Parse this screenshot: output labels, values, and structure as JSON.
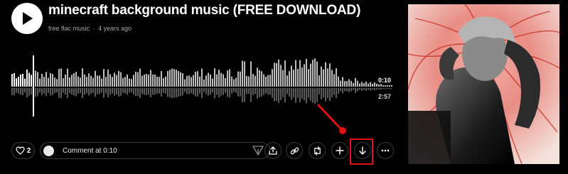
{
  "track": {
    "title": "minecraft background music (FREE DOWNLOAD)",
    "artist": "free flac music",
    "separator": "·",
    "age": "4 years ago"
  },
  "player": {
    "current_time": "0:10",
    "total_time": "2:57",
    "progress_fraction": 0.056
  },
  "actions": {
    "like_count": "2",
    "comment_placeholder": "Comment at 0:10",
    "icons": [
      "heart-icon",
      "send-icon",
      "share-icon",
      "link-icon",
      "repost-icon",
      "plus-icon",
      "download-icon",
      "more-icon"
    ]
  },
  "annotation": {
    "highlight_color": "#e01111"
  },
  "artwork": {
    "description_icon": "track-artwork"
  }
}
